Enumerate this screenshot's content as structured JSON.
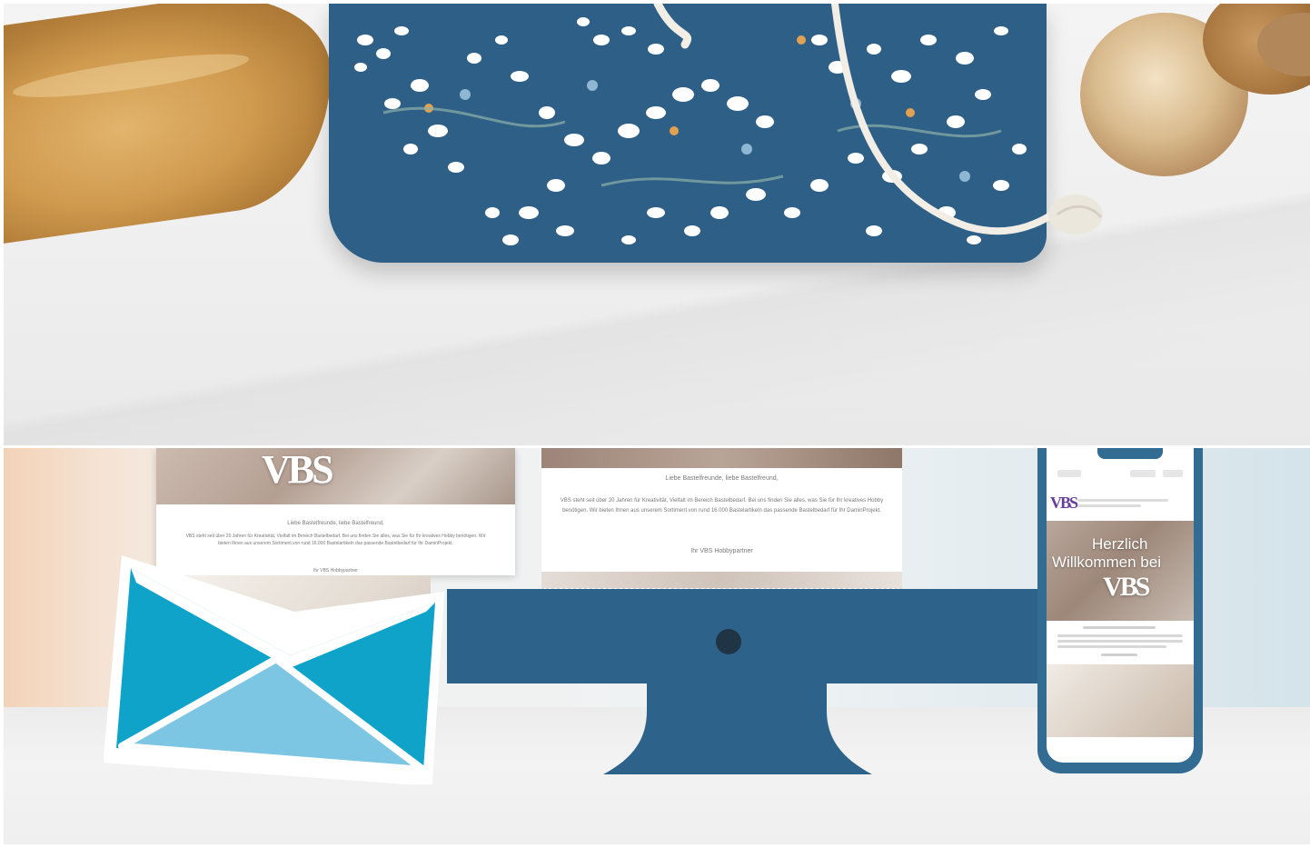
{
  "top_banner": {
    "alt": "Blue bread bag with white floral print and cotton drawstring next to a baguette and bread rolls"
  },
  "bottom_banner": {
    "logo_text": "VBS",
    "email_greeting": "Liebe Bastelfreunde, liebe Bastelfreund,",
    "email_body": "VBS steht seit über 20 Jahren für Kreativität, Vielfalt im Bereich Bastelbedarf. Bei uns finden Sie alles, was Sie für Ihr kreatives Hobby benötigen. Wir bieten Ihnen aus unserem Sortiment von rund 16.000 Bastelartikeln das passende Bastelbedarf für Ihr DaminProjekt.",
    "email_signoff": "Ihr VBS Hobbypartner",
    "phone_welcome_line1": "Herzlich",
    "phone_welcome_line2": "Willkommen bei",
    "colors": {
      "monitor": "#2d638b",
      "phone": "#336c93",
      "envelope_front": "#0fa3c9",
      "envelope_flap": "#7cc6e4"
    }
  }
}
